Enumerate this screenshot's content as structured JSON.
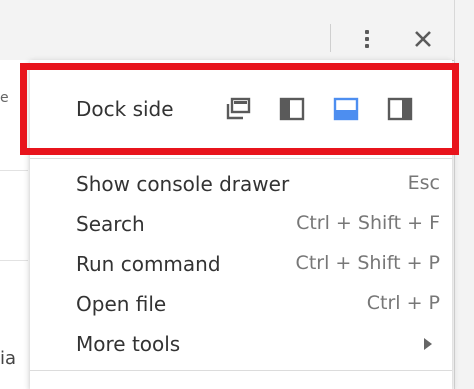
{
  "menu": {
    "dock_side": {
      "label": "Dock side",
      "options": [
        "undock-into-separate-window-icon",
        "dock-to-left-icon",
        "dock-to-bottom-icon",
        "dock-to-right-icon"
      ],
      "selected": "dock-to-bottom-icon"
    },
    "items": [
      {
        "label": "Show console drawer",
        "shortcut": "Esc"
      },
      {
        "label": "Search",
        "shortcut": "Ctrl + Shift + F"
      },
      {
        "label": "Run command",
        "shortcut": "Ctrl + Shift + P"
      },
      {
        "label": "Open file",
        "shortcut": "Ctrl + P"
      },
      {
        "label": "More tools",
        "shortcut": ""
      }
    ]
  },
  "toolbar": {
    "icons": [
      "more-options-icon",
      "close-icon"
    ]
  },
  "background": {
    "left_edge_text": "ia"
  },
  "colors": {
    "highlight": "#e8141c",
    "selected_icon": "#4d8ef0",
    "icon_default": "#5a5a5a"
  }
}
